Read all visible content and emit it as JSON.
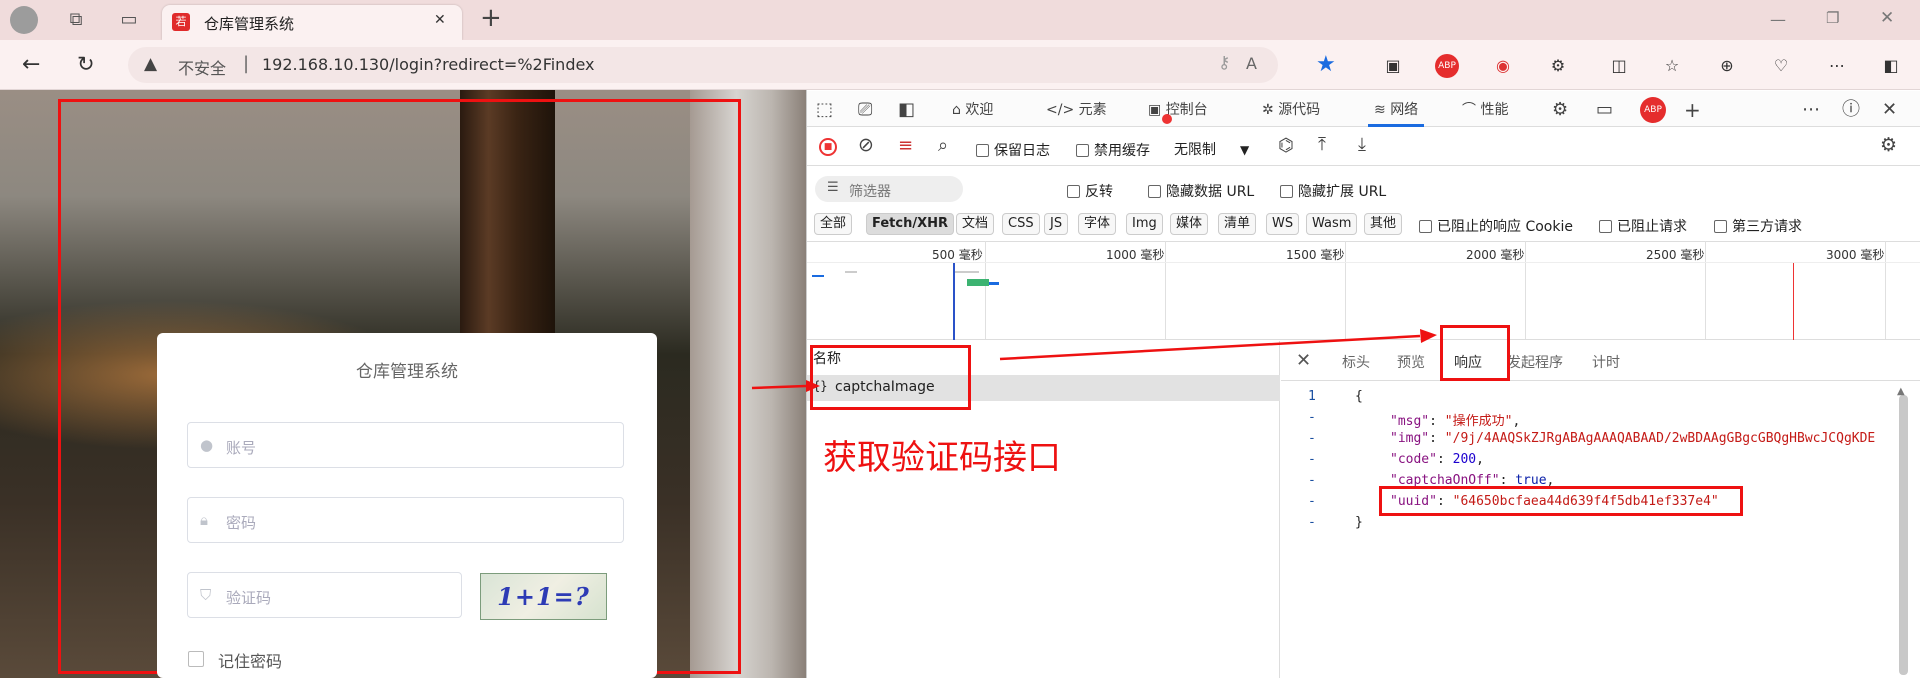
{
  "browser": {
    "tab_title": "仓库管理系统",
    "tab_favicon": "若",
    "new_tab": "+",
    "close": "✕",
    "url_warning": "不安全",
    "url": "192.168.10.130/login?redirect=%2Findex"
  },
  "login": {
    "title": "仓库管理系统",
    "username_placeholder": "账号",
    "password_placeholder": "密码",
    "captcha_placeholder": "验证码",
    "captcha_image": "1+1=?",
    "remember": "记住密码"
  },
  "devtools": {
    "tabs": [
      "欢迎",
      "元素",
      "控制台",
      "源代码",
      "网络",
      "性能"
    ],
    "toolbar": {
      "preserve_log": "保留日志",
      "disable_cache": "禁用缓存",
      "throttle": "无限制"
    },
    "filter": {
      "placeholder": "筛选器",
      "invert": "反转",
      "hide_data_url": "隐藏数据 URL",
      "hide_ext_url": "隐藏扩展 URL"
    },
    "types": [
      "全部",
      "Fetch/XHR",
      "文档",
      "CSS",
      "JS",
      "字体",
      "Img",
      "媒体",
      "清单",
      "WS",
      "Wasm",
      "其他"
    ],
    "blocked_cookies": "已阻止的响应 Cookie",
    "blocked_requests": "已阻止请求",
    "third_party": "第三方请求",
    "ticks": [
      "500 毫秒",
      "1000 毫秒",
      "1500 毫秒",
      "2000 毫秒",
      "2500 毫秒",
      "3000 毫秒"
    ],
    "name_header": "名称",
    "request_name": "captchaImage",
    "detail_tabs": [
      "标头",
      "预览",
      "响应",
      "发起程序",
      "计时"
    ],
    "annotation": "获取验证码接口",
    "response_lines": [
      {
        "num": "1",
        "text": "{"
      },
      {
        "num": "-",
        "key": "\"msg\"",
        "val": "\"操作成功\"",
        "type": "str",
        "comma": ","
      },
      {
        "num": "-",
        "key": "\"img\"",
        "val": "\"/9j/4AAQSkZJRgABAgAAAQABAAD/2wBDAAgGBgcGBQgHBwcJCQgKDE",
        "type": "str",
        "comma": ""
      },
      {
        "num": "-",
        "key": "\"code\"",
        "val": "200",
        "type": "num",
        "comma": ","
      },
      {
        "num": "-",
        "key": "\"captchaOnOff\"",
        "val": "true",
        "type": "kw",
        "comma": ","
      },
      {
        "num": "-",
        "key": "\"uuid\"",
        "val": "\"64650bcfaea44d639f4f5db41ef337e4\"",
        "type": "str",
        "comma": ""
      },
      {
        "num": "-",
        "text": "}"
      }
    ]
  }
}
